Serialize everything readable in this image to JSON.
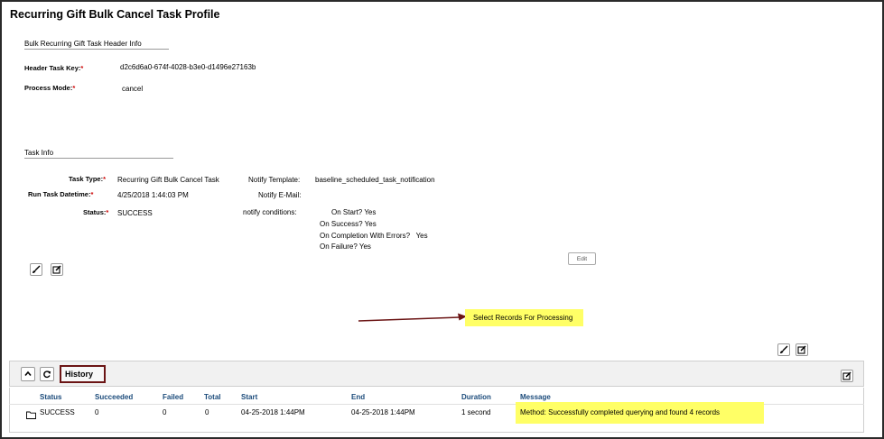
{
  "page": {
    "title": "Recurring Gift Bulk Cancel Task Profile"
  },
  "header_info": {
    "section_title": "Bulk Recurring Gift Task Header Info",
    "task_key_label": "Header Task Key:",
    "task_key_required": "*",
    "task_key_value": "d2c6d6a0-674f-4028-b3e0-d1496e27163b",
    "process_mode_label": "Process Mode:",
    "process_mode_required": "*",
    "process_mode_value": "cancel"
  },
  "task_info": {
    "section_title": "Task Info",
    "task_type_label": "Task Type:",
    "task_type_value": "Recurring Gift Bulk Cancel Task",
    "run_label": "Run Task Datetime:",
    "run_value": "4/25/2018 1:44:03 PM",
    "status_label": "Status:",
    "status_value": "SUCCESS",
    "required": "*",
    "notify_template_label": "Notify Template:",
    "notify_template_value": "baseline_scheduled_task_notification",
    "notify_email_label": "Notify E-Mail:",
    "notify_conditions_label": "notify conditions:",
    "conditions": [
      {
        "label": "On Start?",
        "value": "Yes"
      },
      {
        "label": "On Success?",
        "value": "Yes"
      },
      {
        "label": "On Completion With Errors?",
        "value": "Yes"
      },
      {
        "label": "On Failure?",
        "value": "Yes"
      }
    ],
    "edit_label": "Edit"
  },
  "annotation": {
    "select_records_label": "Select Records For Processing"
  },
  "history": {
    "title": "History",
    "columns": [
      "Status",
      "Succeeded",
      "Failed",
      "Total",
      "Start",
      "End",
      "Duration",
      "Message"
    ],
    "rows": [
      {
        "status": "SUCCESS",
        "succeeded": "0",
        "failed": "0",
        "total": "0",
        "start": "04-25-2018 1:44PM",
        "end": "04-25-2018 1:44PM",
        "duration": "1 second",
        "message": "Method: Successfully completed querying and found 4 records"
      }
    ]
  },
  "colors": {
    "highlight": "#ffff66",
    "history_border": "#6b1414",
    "arrow": "#6b1414",
    "column_header": "#1a4a7a",
    "required": "#cc0000"
  },
  "icons": {
    "brush": "brush-icon",
    "edit": "edit-icon",
    "collapse": "chevron-up-icon",
    "refresh": "refresh-icon",
    "folder": "folder-icon"
  }
}
